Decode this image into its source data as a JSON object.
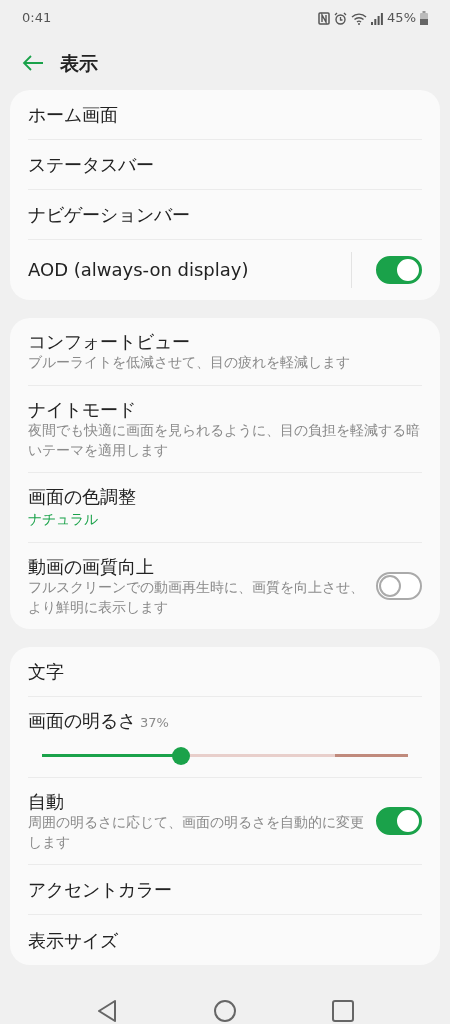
{
  "status_bar": {
    "time": "0:41",
    "battery": "45%"
  },
  "header": {
    "title": "表示"
  },
  "cards": [
    {
      "rows": [
        {
          "kind": "plain",
          "title": "ホーム画面"
        },
        {
          "kind": "plain",
          "title": "ステータスバー"
        },
        {
          "kind": "plain",
          "title": "ナビゲーションバー"
        },
        {
          "kind": "toggle",
          "title": "AOD (always-on display)",
          "on": true,
          "divider": true
        }
      ]
    },
    {
      "rows": [
        {
          "kind": "plain",
          "title": "コンフォートビュー",
          "subtitle": "ブルーライトを低減させて、目の疲れを軽減します"
        },
        {
          "kind": "plain",
          "title": "ナイトモード",
          "subtitle": "夜間でも快適に画面を見られるように、目の負担を軽減する暗いテーマを適用します"
        },
        {
          "kind": "value",
          "title": "画面の色調整",
          "value": "ナチュラル"
        },
        {
          "kind": "toggle",
          "title": "動画の画質向上",
          "subtitle": "フルスクリーンでの動画再生時に、画質を向上させ、より鮮明に表示します",
          "on": false
        }
      ]
    },
    {
      "rows": [
        {
          "kind": "plain",
          "title": "文字"
        },
        {
          "kind": "slider",
          "title": "画面の明るさ",
          "reading": "37%",
          "level": 0.38
        },
        {
          "kind": "toggle",
          "title": "自動",
          "subtitle": "周囲の明るさに応じて、画面の明るさを自動的に変更します",
          "on": true
        },
        {
          "kind": "plain",
          "title": "アクセントカラー"
        },
        {
          "kind": "plain",
          "title": "表示サイズ"
        }
      ]
    }
  ]
}
